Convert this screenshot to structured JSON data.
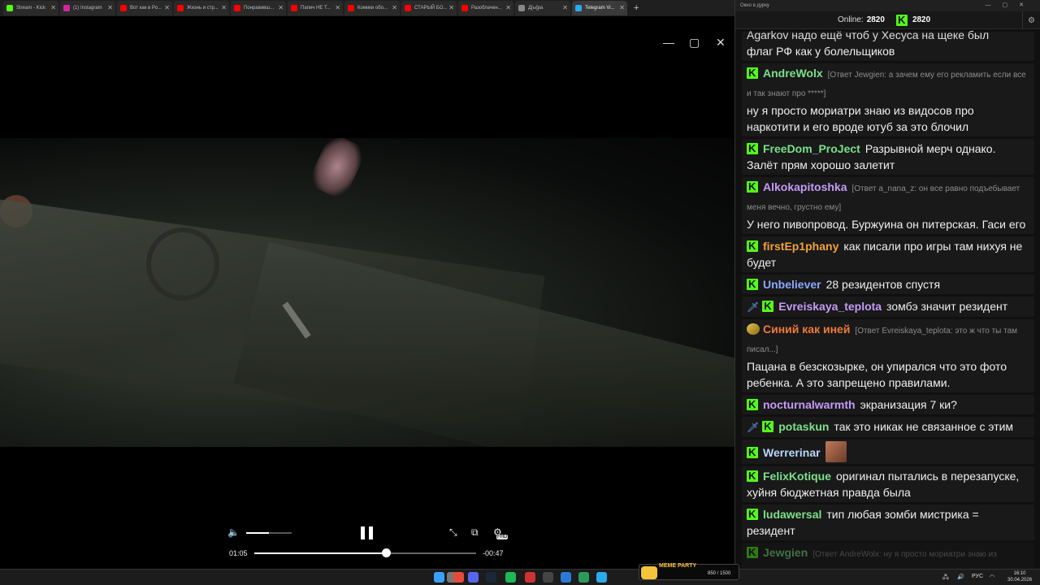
{
  "browser": {
    "tabs": [
      {
        "label": "Stream - Kick",
        "color": "#53fc18"
      },
      {
        "label": "(1) Instagram",
        "color": "#d6249f"
      },
      {
        "label": "Вот как в Ро...",
        "color": "#ff0000"
      },
      {
        "label": "Жизнь и стр...",
        "color": "#ff0000"
      },
      {
        "label": "Понравивш...",
        "color": "#ff0000"
      },
      {
        "label": "Папич НЕ Т...",
        "color": "#ff0000"
      },
      {
        "label": "Комики обо...",
        "color": "#ff0000"
      },
      {
        "label": "СТАРЫЙ БО...",
        "color": "#ff0000"
      },
      {
        "label": "Разоблачен...",
        "color": "#ff0000"
      },
      {
        "label": "Д[ы]ра",
        "color": "#888888"
      },
      {
        "label": "Telegram Vi...",
        "color": "#2aabee",
        "active": true
      }
    ],
    "new_tab": "+"
  },
  "player": {
    "window_controls": {
      "minimize": "—",
      "restore": "▢",
      "close": "✕"
    },
    "time_elapsed": "01:05",
    "time_remaining": "-00:47",
    "progress": 0.592,
    "volume": 0.5,
    "hd_label": "FHD"
  },
  "chat": {
    "window_title": "Окно в дурку",
    "online_label": "Online:",
    "online_count": "2820",
    "viewer_count": "2820",
    "messages": [
      {
        "user": "",
        "color": "#e0e0e0",
        "text": "флаг РФ как у болельщиков",
        "top": "Agarkov надо ещё чтоб у Хесуса на щеке был"
      },
      {
        "user": "AndreWolx",
        "color": "#7be08a",
        "reply": "[Ответ Jewgien: а зачем ему его рекламить если все и так знают про *****]",
        "text": "ну я просто мориатри знаю из видосов про наркотити и его вроде ютуб за это блочил"
      },
      {
        "user": "FreeDom_ProJect",
        "color": "#7be08a",
        "text": "Разрывной мерч однако. Залёт прям хорошо залетит"
      },
      {
        "user": "Alkokapitoshka",
        "color": "#c59cf7",
        "reply": "[Ответ a_nana_z: он все равно подъебывает меня вечно, грустно ему]",
        "text": "У него пивопровод. Буржуина он питерская. Гаси его"
      },
      {
        "user": "firstEp1phany",
        "color": "#f0a33a",
        "text": "как писали про игры там нихуя не будет"
      },
      {
        "user": "Unbeliever",
        "color": "#8aa8ff",
        "text": "28 резидентов спустя"
      },
      {
        "user": "Evreiskaya_teplota",
        "color": "#c59cf7",
        "text": "зомбэ значит резидент",
        "sword": true
      },
      {
        "user": "Синий как иней",
        "color": "#f07a3a",
        "reply": "[Ответ Evreiskaya_teplota: это ж что ты там писал...]",
        "text": "Пацана в безскозырке, он упирался что это фото ребенка. А это запрещено правилами.",
        "avatar": true
      },
      {
        "user": "nocturnalwarmth",
        "color": "#c59cf7",
        "text": "экранизация 7 ки?"
      },
      {
        "user": "potaskun",
        "color": "#7be08a",
        "text": "так это никак не связанное с этим",
        "sword": true
      },
      {
        "user": "Werrerinar",
        "color": "#b8d8f8",
        "text": "",
        "emote": true
      },
      {
        "user": "FelixKotique",
        "color": "#7be08a",
        "text": "оригинал пытались в перезапуске, хуйня бюджетная правда была"
      },
      {
        "user": "ludawersal",
        "color": "#7be08a",
        "text": "тип любая зомби мистрика = резидент"
      },
      {
        "user": "Jewgien",
        "color": "#7be08a",
        "reply": "[Ответ AndreWolx: ну я просто мориатри знаю из видосов про наркотити и его вроде ютуб за это блочил]",
        "text": "",
        "faded": true
      }
    ]
  },
  "taskbar": {
    "meme_title": "MEME PARTY",
    "meme_count": "850 / 1500",
    "lang": "РУС",
    "time": "16:10",
    "date": "30.04.2026"
  }
}
